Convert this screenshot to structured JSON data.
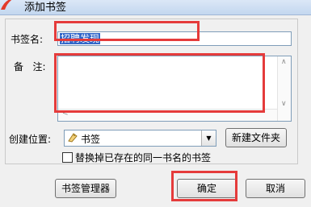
{
  "window": {
    "title": "添加书签"
  },
  "form": {
    "name_label": "书签名:",
    "name_value": "招聘发现",
    "note_label": "备   注:",
    "location_label": "创建位置:",
    "location_value": "书签",
    "new_folder_label": "新建文件夹",
    "replace_label": "替换掉已存在的同一书名的书签"
  },
  "buttons": {
    "manager": "书签管理器",
    "ok": "确定",
    "cancel": "取消"
  },
  "colors": {
    "highlight": "#e53b3b",
    "selection": "#3166c9"
  }
}
